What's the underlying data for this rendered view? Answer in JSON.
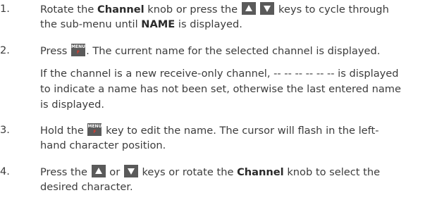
{
  "steps": [
    {
      "number": "1.",
      "lines": [
        {
          "a": "Rotate the ",
          "b": "Channel",
          "c": " knob or press the ",
          "d": " keys to cycle through"
        },
        {
          "a": "the sub-menu until ",
          "b": "NAME",
          "c": " is displayed."
        }
      ]
    },
    {
      "number": "2.",
      "lines": [
        {
          "a": "Press ",
          "b": ". The current name for the selected channel is displayed."
        },
        {
          "a": "If the channel is a new receive-only channel, -- -- -- -- -- -- is displayed"
        },
        {
          "a": "to indicate a name has not been set, otherwise the last entered name"
        },
        {
          "a": "is displayed."
        }
      ]
    },
    {
      "number": "3.",
      "lines": [
        {
          "a": "Hold the ",
          "b": " key to edit the name. The cursor will flash in the left-"
        },
        {
          "a": "hand character position."
        }
      ]
    },
    {
      "number": "4.",
      "lines": [
        {
          "a": "Press the ",
          "b": " or ",
          "c": " keys or rotate the ",
          "d": "Channel",
          "e": " knob to select the"
        },
        {
          "a": "desired character."
        }
      ]
    }
  ],
  "key_labels": {
    "menu_top": "MENU",
    "menu_bottom": "F"
  },
  "icons": {
    "up": "up-arrow-key-icon",
    "down": "down-arrow-key-icon",
    "menu": "menu-f-key-icon"
  },
  "colors": {
    "text": "#3c3c3c",
    "key_bg": "#5a5a5a",
    "key_f": "#e03a2e"
  }
}
